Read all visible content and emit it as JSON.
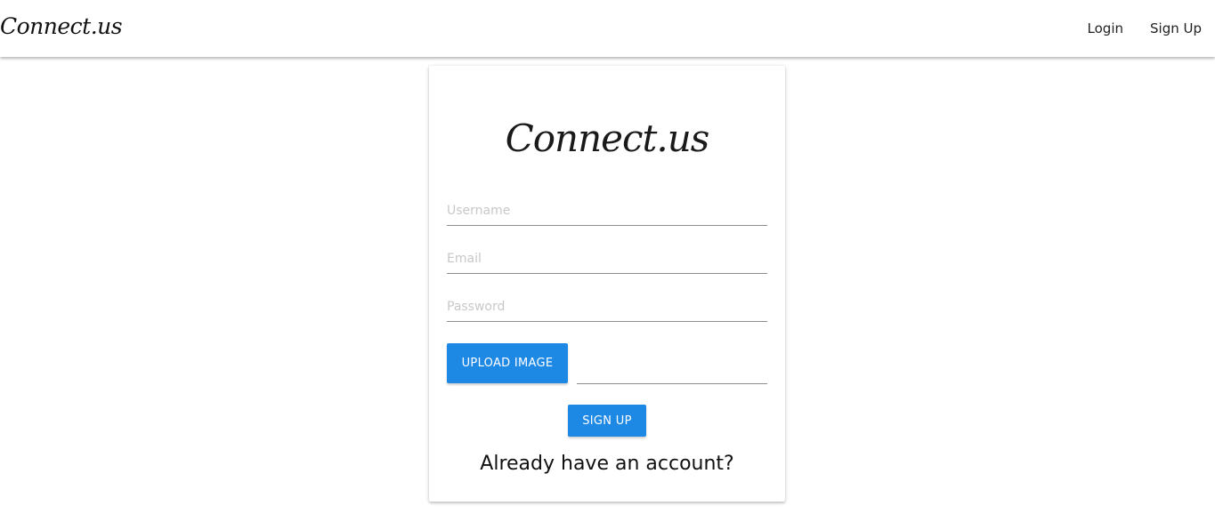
{
  "navbar": {
    "brand": "Connect.us",
    "links": [
      {
        "label": "Login"
      },
      {
        "label": "Sign Up"
      }
    ]
  },
  "card": {
    "logo": "Connect.us",
    "username": {
      "placeholder": "Username",
      "value": ""
    },
    "email": {
      "placeholder": "Email",
      "value": ""
    },
    "password": {
      "placeholder": "Password",
      "value": ""
    },
    "upload_button_label": "UPLOAD IMAGE",
    "file_name": "",
    "signup_button_label": "SIGN UP",
    "signin_prompt": "Already have an account?"
  },
  "colors": {
    "primary_button": "#1e88e5",
    "button_text": "#ffffff",
    "background": "#ffffff"
  }
}
